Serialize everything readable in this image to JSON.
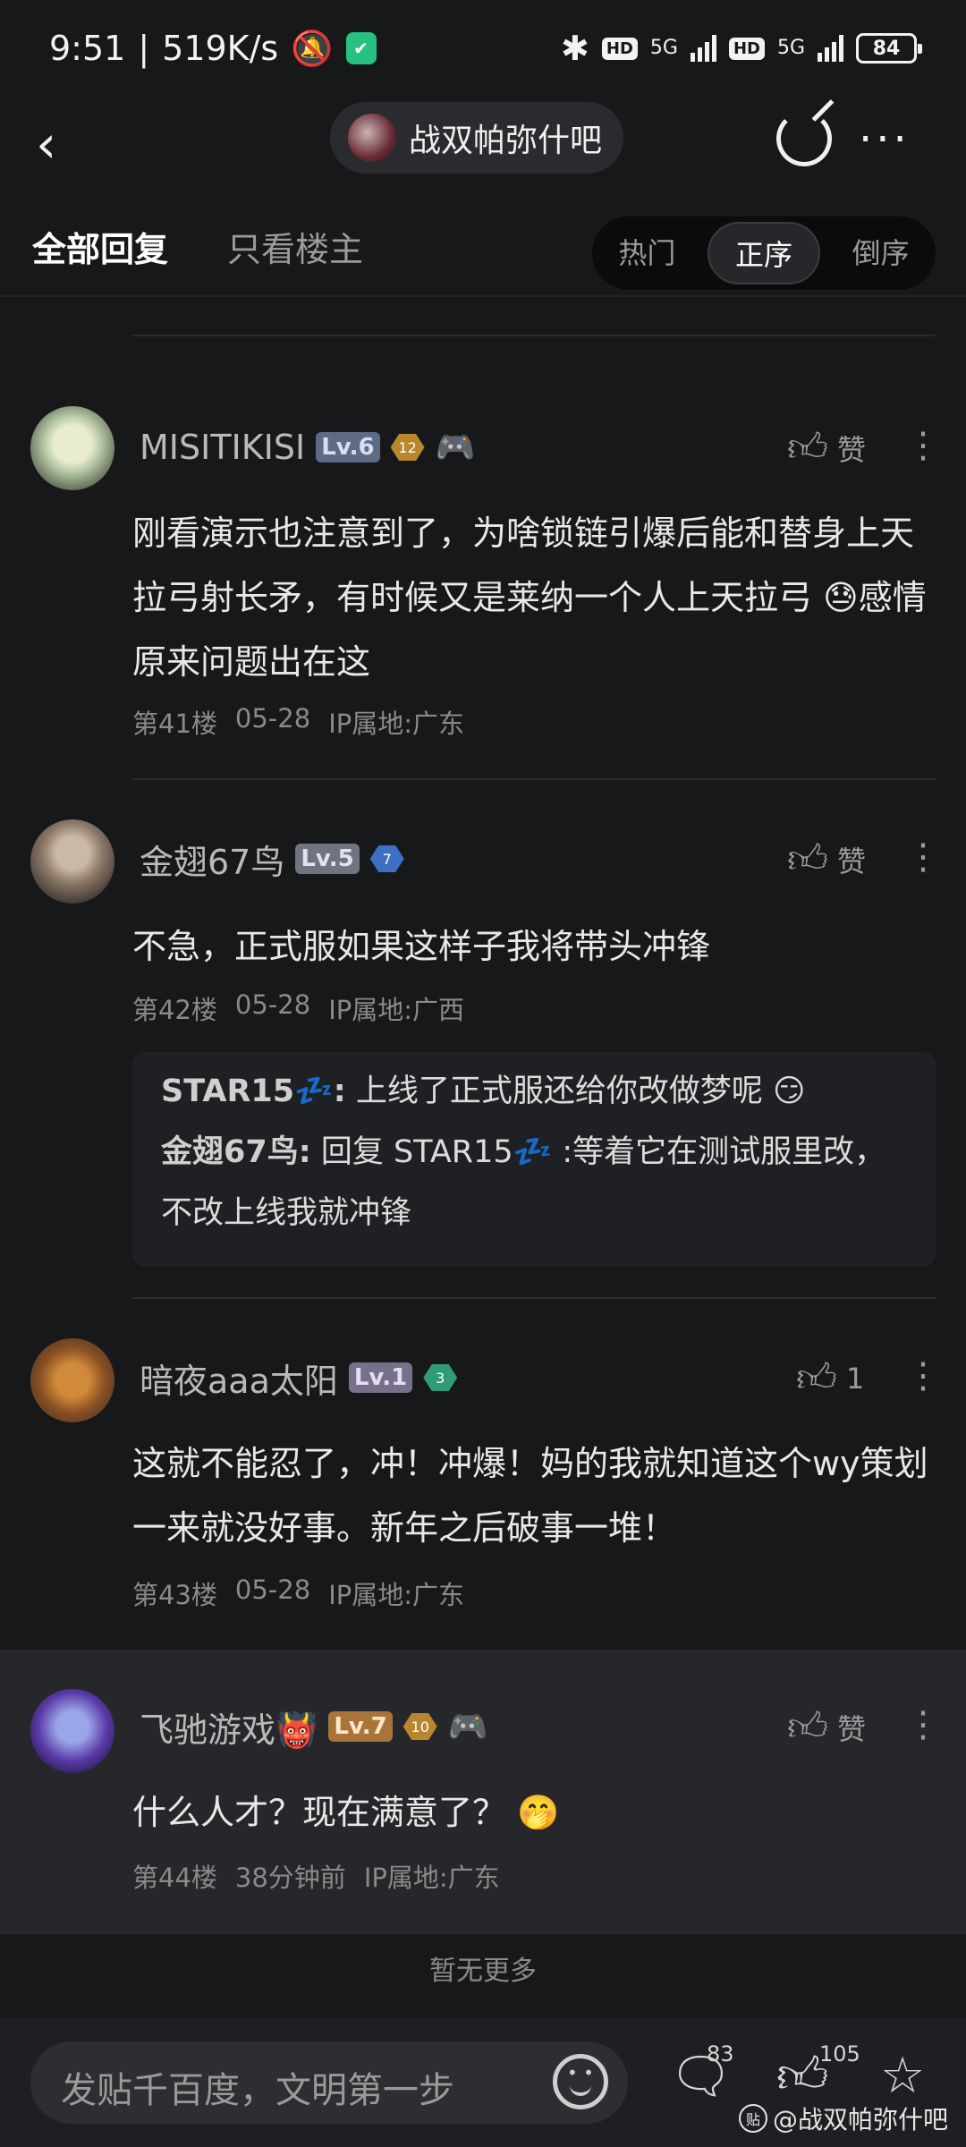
{
  "status": {
    "time": "9:51",
    "speed": "519K/s",
    "network1": "5G",
    "network2": "5G",
    "hd": "HD",
    "battery": "84"
  },
  "nav": {
    "forum_name": "战双帕弥什吧"
  },
  "tabs": {
    "all": "全部回复",
    "owner": "只看楼主",
    "sort": [
      "热门",
      "正序",
      "倒序"
    ],
    "active_sort": "正序"
  },
  "posts": [
    {
      "username": "MISITIKISI",
      "level": "Lv.6",
      "badge": "12",
      "like_label": "赞",
      "content": "刚看演示也注意到了，为啥锁链引爆后能和替身上天拉弓射长矛，有时候又是莱纳一个人上天拉弓 😓感情原来问题出在这",
      "floor": "第41楼",
      "date": "05-28",
      "ip": "IP属地:广东"
    },
    {
      "username": "金翅67鸟",
      "level": "Lv.5",
      "badge": "7",
      "like_label": "赞",
      "content": "不急，正式服如果这样子我将带头冲锋",
      "floor": "第42楼",
      "date": "05-28",
      "ip": "IP属地:广西",
      "replies": [
        {
          "who": "STAR15💤:",
          "text": " 上线了正式服还给你改做梦呢 😏"
        },
        {
          "who": "金翅67鸟:",
          "text": " 回复 STAR15💤 :等着它在测试服里改，不改上线我就冲锋"
        }
      ]
    },
    {
      "username": "暗夜aaa太阳",
      "level": "Lv.1",
      "badge": "3",
      "like_label": "1",
      "content": "这就不能忍了，冲！冲爆！妈的我就知道这个wy策划一来就没好事。新年之后破事一堆！",
      "floor": "第43楼",
      "date": "05-28",
      "ip": "IP属地:广东"
    },
    {
      "username": "飞驰游戏👹",
      "level": "Lv.7",
      "badge": "10",
      "like_label": "赞",
      "content": "什么人才？现在满意了？ 🤭",
      "floor": "第44楼",
      "date": "38分钟前",
      "ip": "IP属地:广东"
    }
  ],
  "footer": {
    "no_more": "暂无更多",
    "composer_placeholder": "发贴千百度，文明第一步",
    "comment_count": "83",
    "like_count": "105",
    "watermark": "@战双帕弥什吧"
  },
  "colors": {
    "background": "#17181a",
    "highlight_row": "#25272a",
    "text_primary": "#e8e8e8",
    "text_secondary": "#8a8a8a"
  }
}
